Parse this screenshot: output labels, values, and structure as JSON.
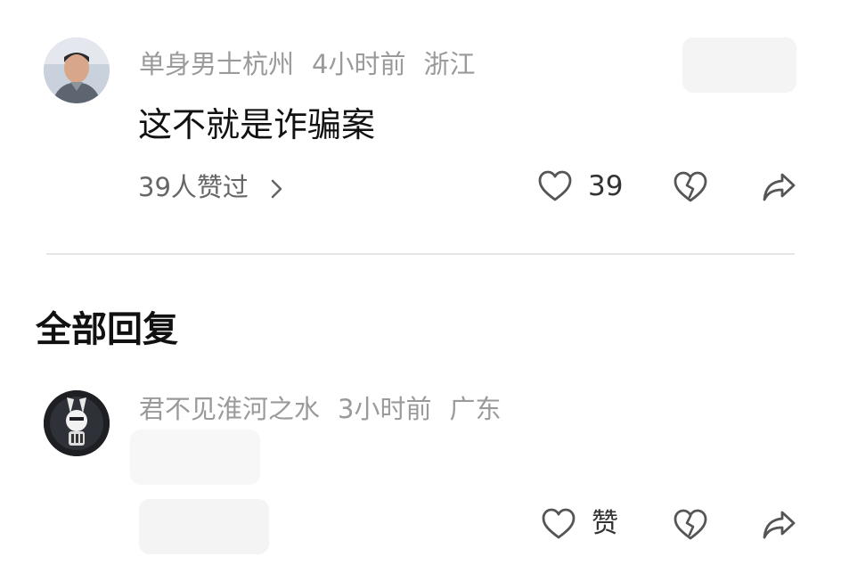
{
  "comment": {
    "username": "单身男士杭州",
    "time": "4小时前",
    "location": "浙江",
    "text": "这不就是诈骗案",
    "likers_summary": "39人赞过",
    "like_count": "39",
    "icons": {
      "like": "heart-icon",
      "dislike": "broken-heart-icon",
      "share": "share-arrow-icon",
      "chevron": "chevron-right-icon"
    }
  },
  "section": {
    "title": "全部回复"
  },
  "reply": {
    "username": "君不见淮河之水",
    "time": "3小时前",
    "location": "广东",
    "like_label": "赞"
  },
  "colors": {
    "meta_gray": "#9a9a9a",
    "text_dark": "#111111",
    "icon_gray": "#555555",
    "divider": "#e6e6e6",
    "placeholder": "#f4f4f4"
  }
}
